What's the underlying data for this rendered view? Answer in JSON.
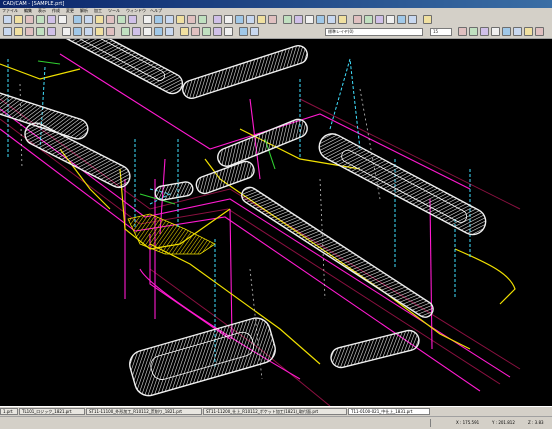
{
  "window": {
    "title": "CAD/CAM - [SAMPLE.prt]"
  },
  "menu": {
    "items": [
      "ファイル",
      "編集",
      "表示",
      "作成",
      "変更",
      "解析",
      "加工",
      "ツール",
      "ウィンドウ",
      "ヘルプ"
    ]
  },
  "toolbar": {
    "icons_row1": [
      "new-icon",
      "open-icon",
      "save-icon",
      "print-icon",
      "cut-icon",
      "delete-icon",
      "copy-icon",
      "paste-icon",
      "undo-icon",
      "redo-icon",
      "help-icon",
      "zoom-icon",
      "pan-icon",
      "rotate-icon",
      "view-front-icon",
      "view-top-icon",
      "view-side-icon",
      "view-iso-icon",
      "wire-icon",
      "shade-icon",
      "layer-icon",
      "grid-icon",
      "snap-icon",
      "measure-icon",
      "select-icon",
      "group-icon",
      "point-icon",
      "line-icon",
      "arc-icon",
      "circle-icon",
      "spline-icon",
      "surface-icon",
      "solid-icon",
      "toolpath-icon",
      "simulate-icon",
      "post-icon",
      "setting-icon"
    ],
    "icons_row2": [
      "layer-manager-icon",
      "color-icon",
      "linetype-icon",
      "attribute-icon",
      "fit-icon",
      "zoom-in-icon",
      "zoom-out-icon",
      "zoom-window-icon",
      "previous-view-icon",
      "redraw-icon",
      "hide-icon",
      "show-icon",
      "filter-icon",
      "properties-icon",
      "tool-list-icon",
      "operation-icon",
      "verify-icon",
      "nc-icon",
      "machine-icon",
      "stock-icon",
      "fixture-icon",
      "coordinate-icon"
    ],
    "layer_combo": "標準レイヤ(0)",
    "scale_combo": "15"
  },
  "file_tabs": [
    {
      "label": "1.prt",
      "active": false
    },
    {
      "label": "TL101_ロジック_1821.prt",
      "active": false
    },
    {
      "label": "ST11-11100_外形加工_R10112_荒削り_1821.prt",
      "active": false
    },
    {
      "label": "ST11-11200_仕上_R10112_ポケット加工(1821)_取付面.prt",
      "active": false
    },
    {
      "label": "T11-0100-021_中仕上_1831.prt",
      "active": true
    }
  ],
  "status": {
    "coord_x": "X : 175.591",
    "coord_y": "Y : 201.812",
    "coord_z": "Z : 3.83"
  },
  "colors": {
    "background": "#000000",
    "model_white": "#f0f0f0",
    "magenta": "#ff1ad0",
    "yellow": "#f0e000",
    "cyan": "#40e0ff",
    "green": "#30d030",
    "dark_red": "#8a1040"
  }
}
